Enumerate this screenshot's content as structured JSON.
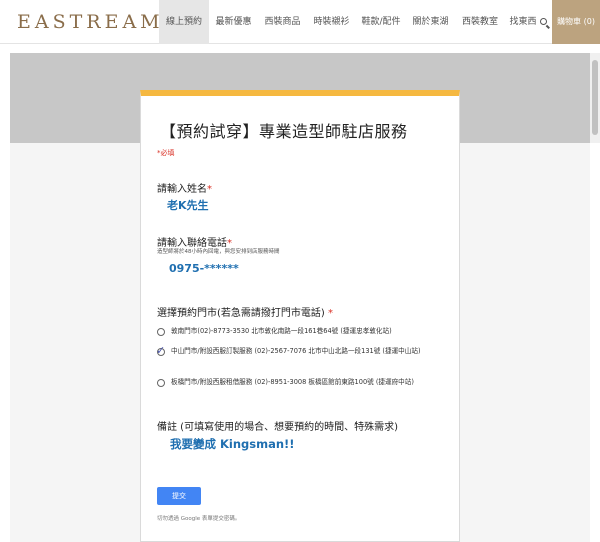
{
  "header": {
    "logo": "EASTREAM",
    "nav": [
      {
        "label": "線上預約",
        "active": true
      },
      {
        "label": "最新優惠",
        "active": false
      },
      {
        "label": "西裝商品",
        "active": false
      },
      {
        "label": "時裝襯衫",
        "active": false
      },
      {
        "label": "鞋款/配件",
        "active": false
      },
      {
        "label": "關於東湖",
        "active": false
      },
      {
        "label": "西裝教室",
        "active": false
      }
    ],
    "search_label": "找東西",
    "cart_label": "購物車 (0)"
  },
  "form": {
    "title": "【預約試穿】專業造型師駐店服務",
    "required_note": "*必填",
    "questions": {
      "name": {
        "label": "請輸入姓名",
        "required": "*",
        "answer": "老K先生"
      },
      "phone": {
        "label": "請輸入聯絡電話",
        "required": "*",
        "help": "造型師將於48小時內回電，與您安排到店服務時間",
        "answer": "0975-******"
      },
      "store": {
        "label": "選擇預約門市(若急需請撥打門市電話)",
        "required": "*",
        "options": [
          {
            "text": "敦南門市(02)-8773-3530 北市敦化南路一段161巷64號 (捷運忠孝敦化站)",
            "selected": false
          },
          {
            "text": "中山門市/附設西服訂製服務 (02)-2567-7076 北市中山北路一段131號 (捷運中山站)",
            "selected": true
          },
          {
            "text": "板橋門市/附設西服租借服務 (02)-8951-3008 板橋區館前東路100號 (捷運府中站)",
            "selected": false
          }
        ]
      },
      "notes": {
        "label": "備註 (可填寫使用的場合、想要預約的時間、特殊需求)",
        "answer": "我要變成 Kingsman!!"
      }
    },
    "submit_label": "提交",
    "footer_note": "切勿透過 Google 表單提交密碼。"
  },
  "colors": {
    "accent": "#f5b840",
    "brand": "#bca37f",
    "answer": "#1f6fb0",
    "submit": "#4285f4"
  }
}
